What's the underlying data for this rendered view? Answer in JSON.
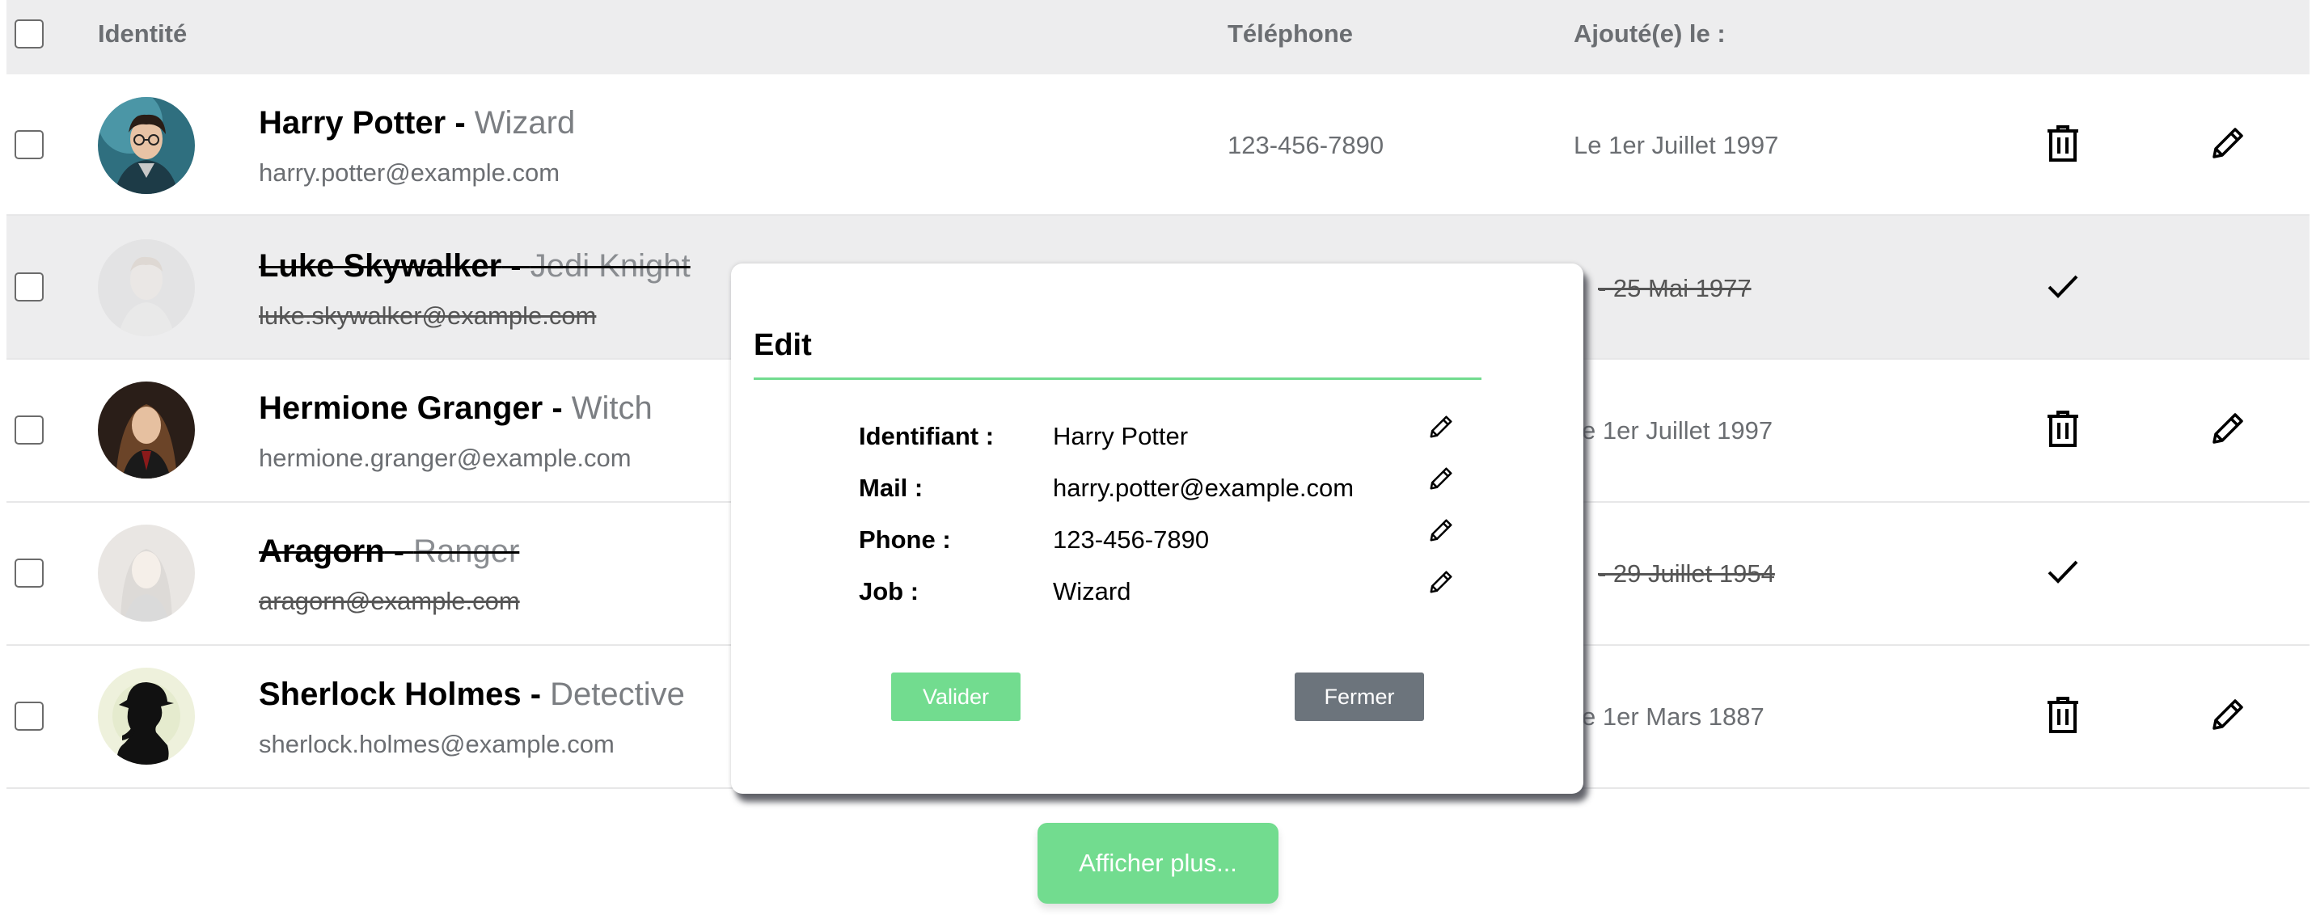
{
  "table": {
    "headers": {
      "identity": "Identité",
      "phone": "Téléphone",
      "added": "Ajouté(e) le :"
    },
    "rows": [
      {
        "name": "Harry Potter",
        "separator": " - ",
        "job": "Wizard",
        "email": "harry.potter@example.com",
        "phone": "123-456-7890",
        "date": "Le 1er Juillet 1997",
        "deleted": false,
        "avatar": "harry-avatar"
      },
      {
        "name": "Luke Skywalker",
        "separator": " - ",
        "job": "Jedi Knight",
        "email": "luke.skywalker@example.com",
        "phone": "",
        "date": "- 25 Mai 1977",
        "deleted": true,
        "avatar": "luke-avatar"
      },
      {
        "name": "Hermione Granger",
        "separator": " - ",
        "job": "Witch",
        "email": "hermione.granger@example.com",
        "phone": "",
        "date": "e 1er Juillet 1997",
        "deleted": false,
        "avatar": "hermione-avatar"
      },
      {
        "name": "Aragorn",
        "separator": " - ",
        "job": "Ranger",
        "email": "aragorn@example.com",
        "phone": "",
        "date": "- 29 Juillet 1954",
        "deleted": true,
        "avatar": "aragorn-avatar"
      },
      {
        "name": "Sherlock Holmes",
        "separator": " - ",
        "job": "Detective",
        "email": "sherlock.holmes@example.com",
        "phone": "",
        "date": "e 1er Mars 1887",
        "deleted": false,
        "avatar": "sherlock-avatar"
      }
    ]
  },
  "show_more": "Afficher plus...",
  "modal": {
    "title": "Edit",
    "fields": [
      {
        "label": "Identifiant :",
        "value": "Harry Potter"
      },
      {
        "label": "Mail :",
        "value": "harry.potter@example.com"
      },
      {
        "label": "Phone :",
        "value": "123-456-7890"
      },
      {
        "label": "Job :",
        "value": "Wizard"
      }
    ],
    "validate_label": "Valider",
    "close_label": "Fermer"
  },
  "colors": {
    "accent_green": "#72dc8f",
    "header_bg": "#ededee",
    "muted_text": "#6b6e72",
    "close_button": "#6c747c"
  },
  "icons": [
    "trash-icon",
    "pencil-icon",
    "check-icon"
  ]
}
